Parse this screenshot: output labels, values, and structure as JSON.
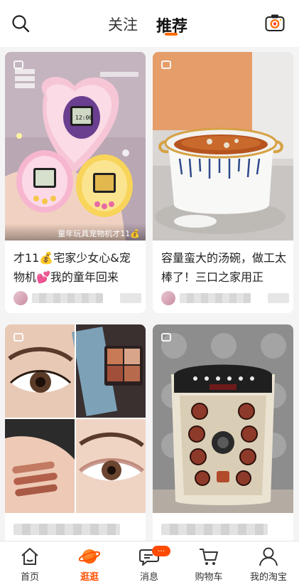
{
  "header": {
    "tabs": [
      {
        "label": "关注",
        "active": false
      },
      {
        "label": "推荐",
        "active": true
      }
    ],
    "accent_color": "#ff6a00"
  },
  "feed": {
    "cards": [
      {
        "title": "才11💰宅家少女心&宠物机💕我的童年回来",
        "image_caption": "童年玩具宠物机才11💰",
        "image_subject": "pink pixel pet handheld toys on fluffy heart pillow",
        "badge_icon": "multi-image-icon"
      },
      {
        "title": "容量蛮大的汤碗，做工太棒了！三口之家用正",
        "image_subject": "white ceramic soup pot with blue stripes",
        "badge_icon": "multi-image-icon"
      },
      {
        "title": "",
        "image_subject": "eye makeup collage with eyeshadow palette and swatches",
        "badge_icon": "multi-image-icon"
      },
      {
        "title": "",
        "image_subject": "electric foot spa basin with massage rollers",
        "badge_icon": "multi-image-icon"
      }
    ]
  },
  "tabbar": {
    "items": [
      {
        "label": "首页",
        "icon": "home-icon",
        "active": false
      },
      {
        "label": "逛逛",
        "icon": "planet-icon",
        "active": true
      },
      {
        "label": "消息",
        "icon": "chat-bubble-icon",
        "active": false,
        "badge": "···"
      },
      {
        "label": "购物车",
        "icon": "cart-icon",
        "active": false
      },
      {
        "label": "我的淘宝",
        "icon": "user-icon",
        "active": false
      }
    ],
    "active_color": "#ff5000"
  }
}
